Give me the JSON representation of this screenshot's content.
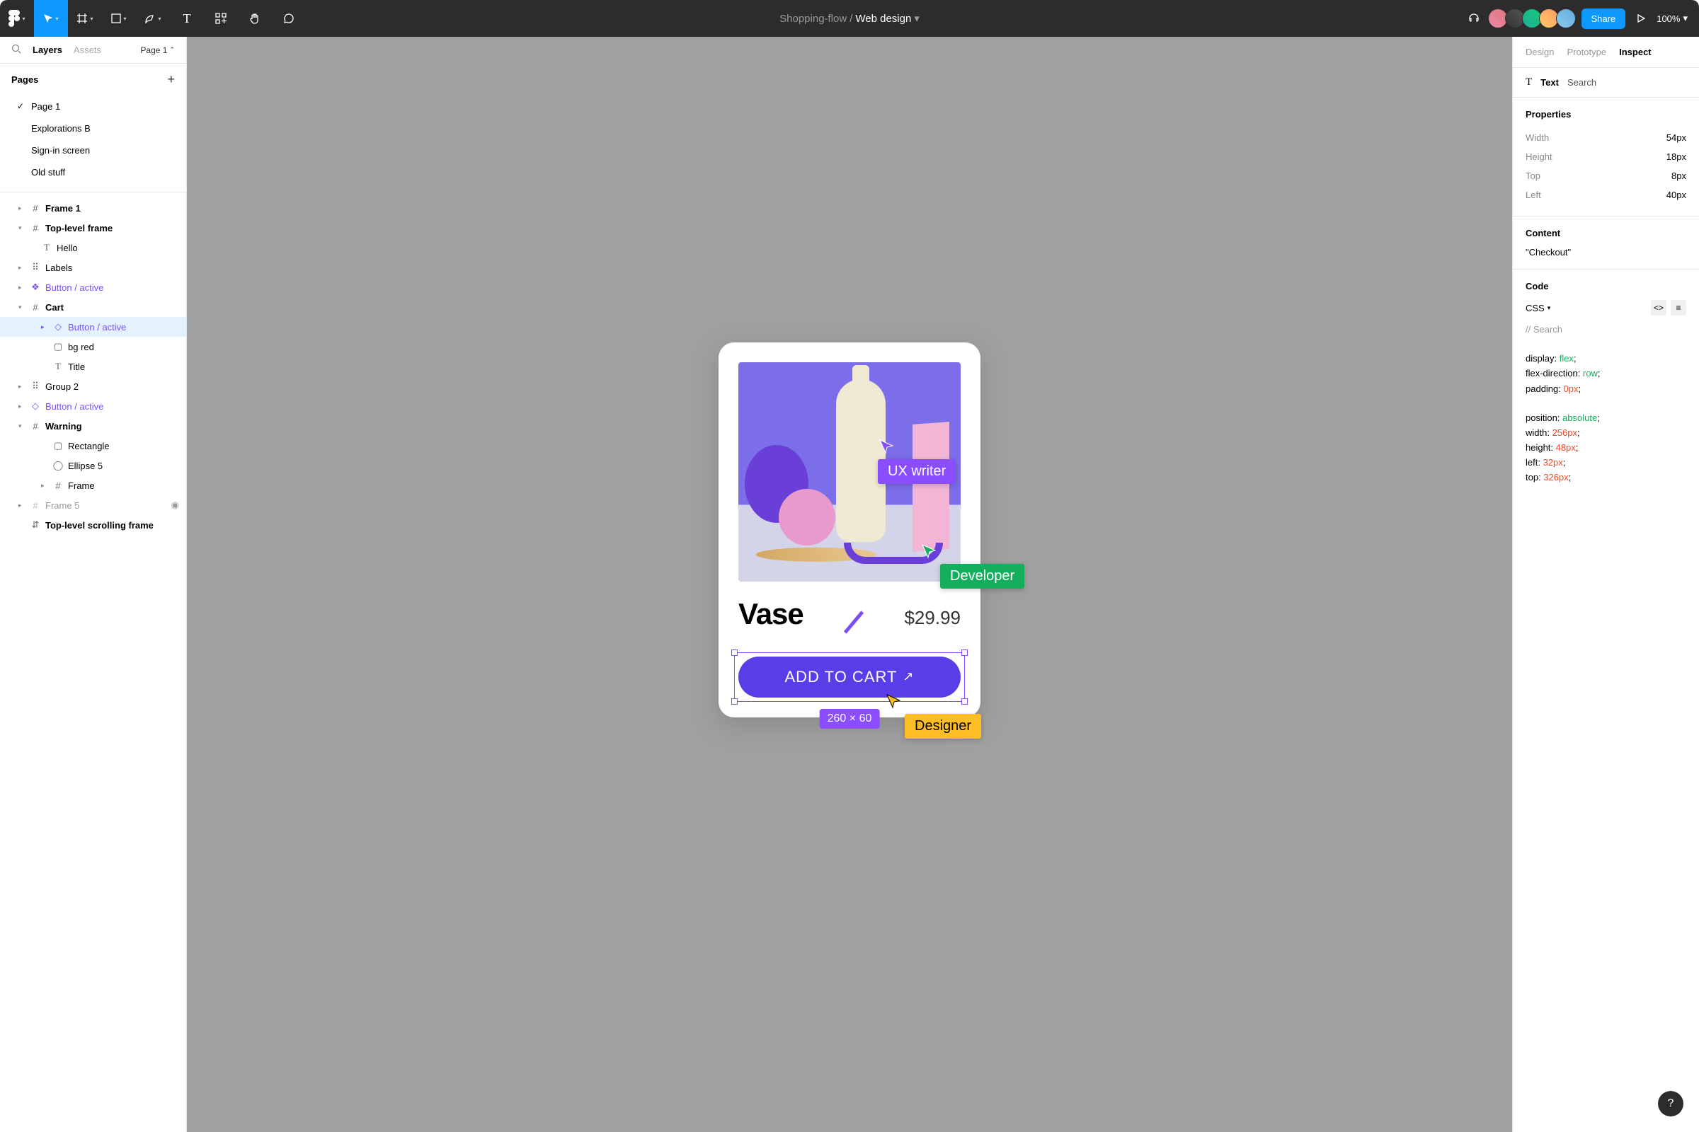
{
  "breadcrumb": {
    "project": "Shopping-flow",
    "page": "Web design"
  },
  "toolbar": {
    "share": "Share",
    "zoom": "100%"
  },
  "leftPanel": {
    "tabs": {
      "layers": "Layers",
      "assets": "Assets"
    },
    "pageSelector": "Page 1",
    "pagesTitle": "Pages",
    "pages": [
      "Page 1",
      "Explorations B",
      "Sign-in screen",
      "Old stuff"
    ],
    "layers": {
      "frame1": "Frame 1",
      "topLevelFrame": "Top-level frame",
      "hello": "Hello",
      "labels": "Labels",
      "buttonActive1": "Button / active",
      "cart": "Cart",
      "buttonActive2": "Button / active",
      "bgRed": "bg red",
      "title": "Title",
      "group2": "Group 2",
      "buttonActive3": "Button / active",
      "warning": "Warning",
      "rectangle": "Rectangle",
      "ellipse5": "Ellipse 5",
      "frame": "Frame",
      "frame5": "Frame 5",
      "scrollingFrame": "Top-level scrolling frame"
    }
  },
  "canvas": {
    "product": {
      "title": "Vase",
      "price": "$29.99",
      "cta": "ADD TO CART"
    },
    "selectionDims": "260 × 60",
    "cursors": {
      "ux": "UX writer",
      "dev": "Developer",
      "des": "Designer"
    }
  },
  "rightPanel": {
    "tabs": {
      "design": "Design",
      "prototype": "Prototype",
      "inspect": "Inspect"
    },
    "textLabel": "Text",
    "searchPlaceholder": "Search",
    "propsTitle": "Properties",
    "props": {
      "widthK": "Width",
      "widthV": "54px",
      "heightK": "Height",
      "heightV": "18px",
      "topK": "Top",
      "topV": "8px",
      "leftK": "Left",
      "leftV": "40px"
    },
    "contentTitle": "Content",
    "contentValue": "\"Checkout\"",
    "codeTitle": "Code",
    "codeLang": "CSS",
    "codeSearch": "// Search",
    "code": {
      "l1a": "display: ",
      "l1b": "flex",
      "l1c": ";",
      "l2a": "flex-direction: ",
      "l2b": "row",
      "l2c": ";",
      "l3a": "padding: ",
      "l3b": "0px",
      "l3c": ";",
      "l5a": "position: ",
      "l5b": "absolute",
      "l5c": ";",
      "l6a": "width: ",
      "l6b": "256px",
      "l6c": ";",
      "l7a": "height: ",
      "l7b": "48px",
      "l7c": ";",
      "l8a": "left: ",
      "l8b": "32px",
      "l8c": ";",
      "l9a": "top: ",
      "l9b": "326px",
      "l9c": ";"
    }
  },
  "help": "?"
}
